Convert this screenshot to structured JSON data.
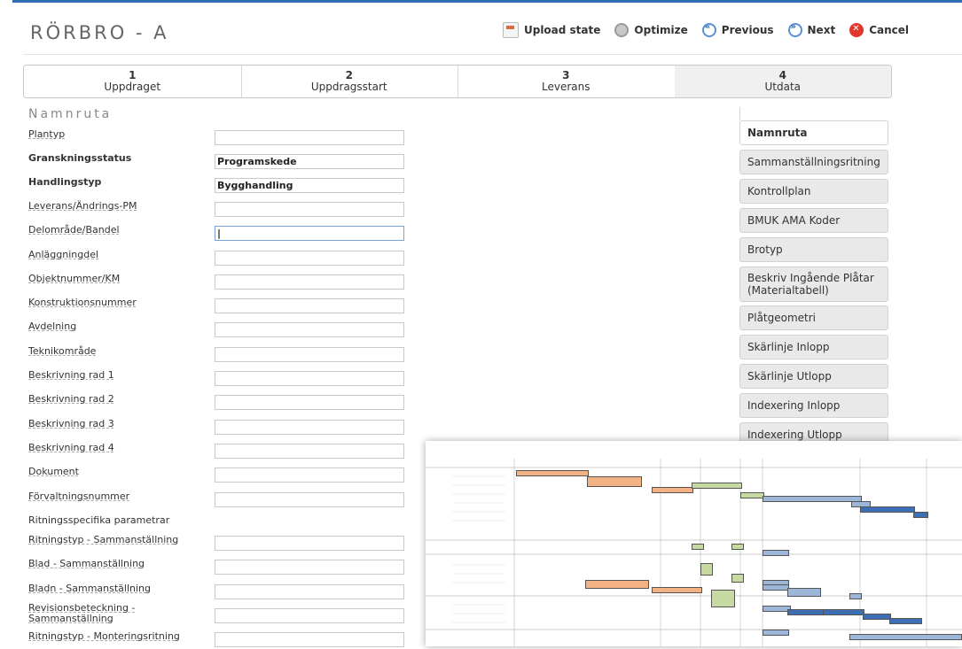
{
  "header": {
    "title": "RÖRBRO - A",
    "toolbar": {
      "upload": "Upload state",
      "optimize": "Optimize",
      "previous": "Previous",
      "next": "Next",
      "cancel": "Cancel"
    }
  },
  "steps": [
    {
      "number": "1",
      "label": "Uppdraget"
    },
    {
      "number": "2",
      "label": "Uppdragsstart"
    },
    {
      "number": "3",
      "label": "Leverans"
    },
    {
      "number": "4",
      "label": "Utdata"
    }
  ],
  "section": {
    "title": "Namnruta"
  },
  "form": {
    "rows": [
      {
        "label": "Plantyp",
        "value": ""
      },
      {
        "label": "Granskningsstatus",
        "value": "Programskede"
      },
      {
        "label": "Handlingstyp",
        "value": "Bygghandling"
      },
      {
        "label": "Leverans/Ändrings-PM",
        "value": ""
      },
      {
        "label": "Delområde/Bandel",
        "value": "|"
      },
      {
        "label": "Anläggningdel",
        "value": ""
      },
      {
        "label": "Objektnummer/KM",
        "value": ""
      },
      {
        "label": "Konstruktionsnummer",
        "value": ""
      },
      {
        "label": "Avdelning",
        "value": ""
      },
      {
        "label": "Teknikområde",
        "value": ""
      },
      {
        "label": "Beskrivning rad 1",
        "value": ""
      },
      {
        "label": "Beskrivning rad 2",
        "value": ""
      },
      {
        "label": "Beskrivning rad 3",
        "value": ""
      },
      {
        "label": "Beskrivning rad 4",
        "value": ""
      },
      {
        "label": "Dokument",
        "value": ""
      },
      {
        "label": "Förvaltningsnummer",
        "value": ""
      },
      {
        "label": "Ritningsspecifika parametrar",
        "value": ""
      },
      {
        "label": "Ritningstyp - Sammanställning",
        "value": ""
      },
      {
        "label": "Blad - Sammanställning",
        "value": ""
      },
      {
        "label": "Bladn - Sammanställning",
        "value": ""
      },
      {
        "label": "Revisionsbeteckning - Sammanställning",
        "value": ""
      },
      {
        "label": "Ritningstyp - Monteringsritning",
        "value": ""
      }
    ]
  },
  "sidebar": {
    "tabs": [
      "Namnruta",
      "Sammanställningsritning",
      "Kontrollplan",
      "BMUK AMA Koder",
      "Brotyp",
      "Beskriv Ingående Plåtar (Materialtabell)",
      "Plåtgeometri",
      "Skärlinje Inlopp",
      "Skärlinje Utlopp",
      "Indexering Inlopp",
      "Indexering Utlopp"
    ]
  },
  "colors": {
    "accent": "#2f6fb5",
    "cancel": "#e0362b",
    "gantt_orange": "#f4b183",
    "gantt_green": "#c5d9a1",
    "gantt_blue": "#9db7db",
    "gantt_darkblue": "#3d6fb5"
  }
}
